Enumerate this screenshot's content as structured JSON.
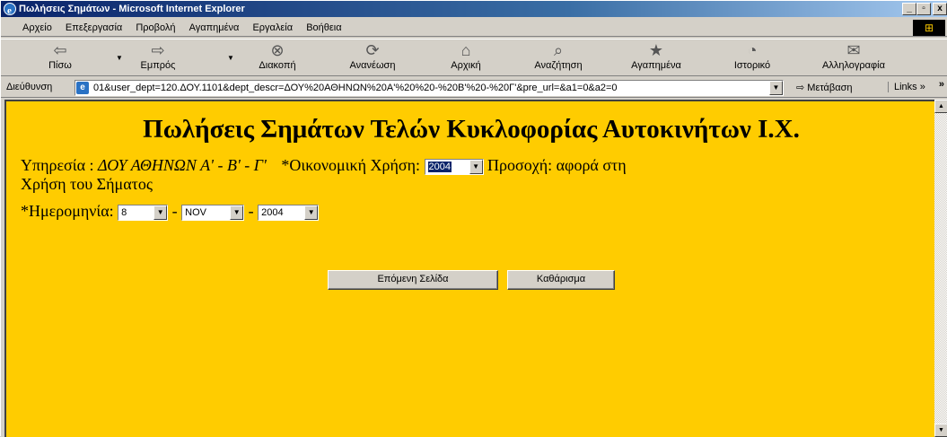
{
  "window": {
    "title": "Πωλήσεις Σημάτων - Microsoft Internet Explorer",
    "minimize": "_",
    "maximize": "▫",
    "close": "x"
  },
  "menu": [
    "Αρχείο",
    "Επεξεργασία",
    "Προβολή",
    "Αγαπημένα",
    "Εργαλεία",
    "Βοήθεια"
  ],
  "toolbar": {
    "back": "Πίσω",
    "forward": "Εμπρός",
    "stop": "Διακοπή",
    "refresh": "Ανανέωση",
    "home": "Αρχική",
    "search": "Αναζήτηση",
    "favorites": "Αγαπημένα",
    "history": "Ιστορικό",
    "mail": "Αλληλογραφία"
  },
  "address": {
    "label": "Διεύθυνση",
    "url": "01&user_dept=120.ΔΟΥ.1101&dept_descr=ΔΟΥ%20ΑΘΗΝΩΝ%20Α'%20%20-%20Β'%20-%20Γ'&pre_url=&a1=0&a2=0",
    "go": "Μετάβαση",
    "links": "Links »"
  },
  "page": {
    "heading": "Πωλήσεις Σημάτων Τελών Κυκλοφορίας Αυτοκινήτων Ι.Χ.",
    "service_label": "Υπηρεσία :",
    "service_value": "ΔΟΥ ΑΘΗΝΩΝ Α' - Β' - Γ'",
    "fiscal_year_label": "*Οικονομική Χρήση:",
    "fiscal_year_value": "2004",
    "note_line1": "Προσοχή: αφορά στη",
    "note_line2": "Χρήση του Σήματος",
    "date_label": "*Ημερομηνία:",
    "day": "8",
    "month": "NOV",
    "year": "2004",
    "sep": "-",
    "next_button": "Επόμενη Σελίδα",
    "clear_button": "Καθάρισμα"
  },
  "colors": {
    "page_bg": "#ffcc00",
    "title_bar": "#0a246a"
  }
}
